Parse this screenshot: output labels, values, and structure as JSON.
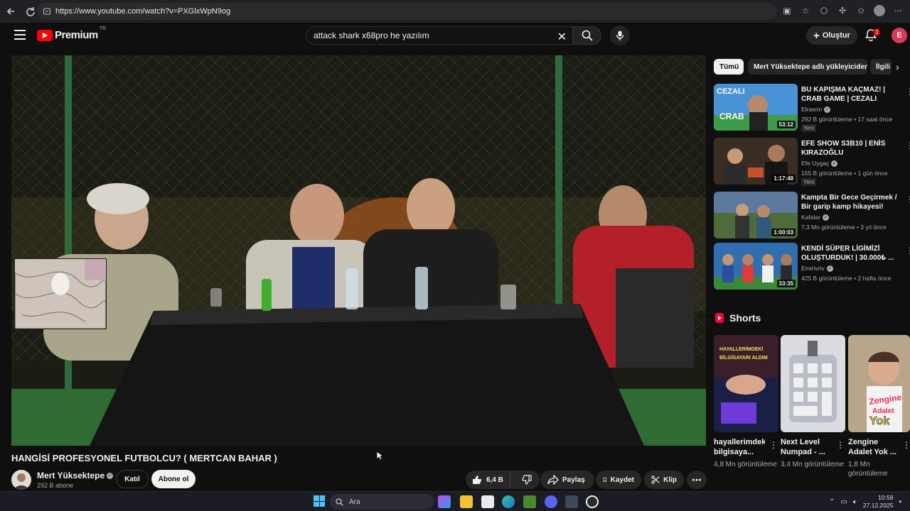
{
  "browser": {
    "url": "https://www.youtube.com/watch?v=PXGlxWpN9og"
  },
  "header": {
    "logo_text": "Premium",
    "logo_region": "TR",
    "search_query": "attack shark x68pro he yazılım",
    "create_label": "Oluştur",
    "notification_count": "3",
    "user_initial": "E"
  },
  "video": {
    "title": "HANGİSİ PROFESYONEL FUTBOLCU? ( MERTCAN BAHAR )",
    "channel": "Mert Yüksektepe",
    "subscribers": "292 B abone",
    "join_label": "Katıl",
    "subscribe_label": "Abone ol",
    "likes": "6,4 B",
    "share_label": "Paylaş",
    "save_label": "Kaydet",
    "clip_label": "Klip"
  },
  "sidebar": {
    "chips": [
      "Tümü",
      "Mert Yüksektepe adlı yükleyiciden",
      "İlgili"
    ],
    "recommendations": [
      {
        "title": "BU KAPIŞMA KAÇMAZ! | CRAB GAME | CEZALI",
        "channel": "Elraenn",
        "meta": "292 B görüntüleme • 17 saat önce",
        "badge": "Yeni",
        "duration": "53:12",
        "thumb_color": "#3c7fc4"
      },
      {
        "title": "EFE SHOW S3B10 | ENİS KIRAZOĞLU",
        "channel": "Efe Uygaç",
        "meta": "155 B görüntüleme • 1 gün önce",
        "badge": "Yeni",
        "duration": "1:17:48",
        "thumb_color": "#3a2e24"
      },
      {
        "title": "Kampta Bir Gece Geçirmek / Bir garip kamp hikayesi!",
        "channel": "Kafalar",
        "meta": "7,3 Mn görüntüleme • 3 yıl önce",
        "badge": "",
        "duration": "1:00:03",
        "thumb_color": "#4e6b3a"
      },
      {
        "title": "KENDİ SÜPER LİGİMİZİ OLUŞTURDUK! | 30.000₺ ...",
        "channel": "Emirivriv",
        "meta": "425 B görüntüleme • 2 hafta önce",
        "badge": "",
        "duration": "33:35",
        "thumb_color": "#2f6fb0"
      }
    ],
    "shorts_title": "Shorts",
    "shorts": [
      {
        "title": "hayallerimdeki bilgisaya...",
        "views": "4,8 Mn görüntüleme",
        "overlay": "HAYALLERİMDEKİ BİLGİSAYARI ALDIM"
      },
      {
        "title": "Next Level Numpad - ...",
        "views": "3,4 Mn görüntüleme",
        "overlay": ""
      },
      {
        "title": "Zengine Adalet Yok ...",
        "views": "1,8 Mn görüntüleme",
        "overlay": "Zengine Adalet Yok Mu ?"
      }
    ]
  },
  "taskbar": {
    "search_placeholder": "Ara",
    "time": "10:58",
    "date": "27.12.2025"
  }
}
